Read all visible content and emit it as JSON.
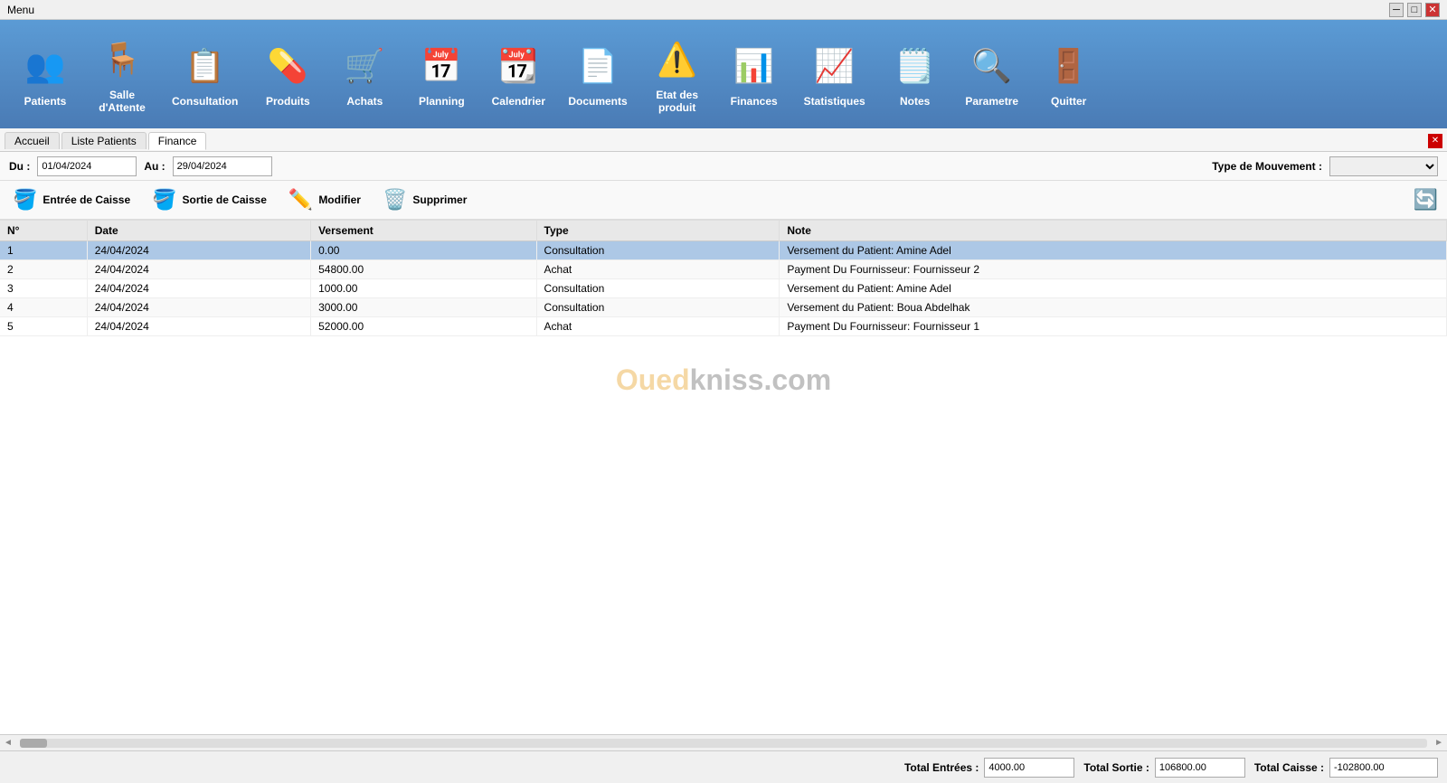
{
  "titlebar": {
    "title": "Menu",
    "buttons": [
      "minimize",
      "restore",
      "close"
    ]
  },
  "toolbar": {
    "items": [
      {
        "id": "patients",
        "label": "Patients",
        "icon": "👥"
      },
      {
        "id": "salle-attente",
        "label": "Salle\nd'Attente",
        "icon": "🪑"
      },
      {
        "id": "consultation",
        "label": "Consultation",
        "icon": "📋"
      },
      {
        "id": "produits",
        "label": "Produits",
        "icon": "💊"
      },
      {
        "id": "achats",
        "label": "Achats",
        "icon": "🛒"
      },
      {
        "id": "planning",
        "label": "Planning",
        "icon": "📅"
      },
      {
        "id": "calendrier",
        "label": "Calendrier",
        "icon": "📆"
      },
      {
        "id": "documents",
        "label": "Documents",
        "icon": "📄"
      },
      {
        "id": "etat-produit",
        "label": "Etat des\nproduit",
        "icon": "⚠️"
      },
      {
        "id": "finances",
        "label": "Finances",
        "icon": "📊"
      },
      {
        "id": "statistiques",
        "label": "Statistiques",
        "icon": "📈"
      },
      {
        "id": "notes",
        "label": "Notes",
        "icon": "🗒️"
      },
      {
        "id": "parametre",
        "label": "Parametre",
        "icon": "🔍"
      },
      {
        "id": "quitter",
        "label": "Quitter",
        "icon": "🚪"
      }
    ]
  },
  "tabs": [
    {
      "id": "accueil",
      "label": "Accueil",
      "active": false
    },
    {
      "id": "liste-patients",
      "label": "Liste Patients",
      "active": false
    },
    {
      "id": "finance",
      "label": "Finance",
      "active": true
    }
  ],
  "filter": {
    "du_label": "Du :",
    "du_value": "01/04/2024",
    "au_label": "Au :",
    "au_value": "29/04/2024",
    "type_mouvement_label": "Type de Mouvement :",
    "type_mouvement_value": ""
  },
  "actions": {
    "entree_caisse": "Entrée de Caisse",
    "sortie_caisse": "Sortie de Caisse",
    "modifier": "Modifier",
    "supprimer": "Supprimer"
  },
  "table": {
    "columns": [
      "N°",
      "Date",
      "Versement",
      "Type",
      "Note"
    ],
    "rows": [
      {
        "num": "1",
        "date": "24/04/2024",
        "versement": "0.00",
        "type": "Consultation",
        "note": "Versement du Patient: Amine Adel",
        "selected": true
      },
      {
        "num": "2",
        "date": "24/04/2024",
        "versement": "54800.00",
        "type": "Achat",
        "note": "Payment Du Fournisseur: Fournisseur 2",
        "selected": false
      },
      {
        "num": "3",
        "date": "24/04/2024",
        "versement": "1000.00",
        "type": "Consultation",
        "note": "Versement du Patient: Amine Adel",
        "selected": false
      },
      {
        "num": "4",
        "date": "24/04/2024",
        "versement": "3000.00",
        "type": "Consultation",
        "note": "Versement du Patient: Boua Abdelhak",
        "selected": false
      },
      {
        "num": "5",
        "date": "24/04/2024",
        "versement": "52000.00",
        "type": "Achat",
        "note": "Payment Du Fournisseur: Fournisseur 1",
        "selected": false
      }
    ]
  },
  "watermark": {
    "oued": "Oued",
    "kniss": "kniss",
    "com": ".com"
  },
  "footer": {
    "total_entrees_label": "Total Entrées :",
    "total_entrees_value": "4000.00",
    "total_sortie_label": "Total Sortie :",
    "total_sortie_value": "106800.00",
    "total_caisse_label": "Total Caisse :",
    "total_caisse_value": "-102800.00"
  }
}
